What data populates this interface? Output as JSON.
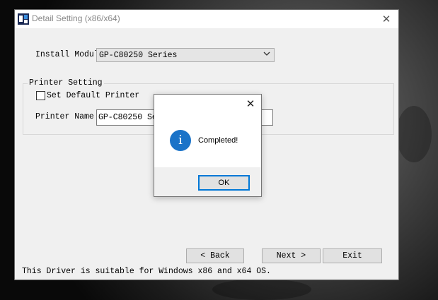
{
  "window": {
    "title": "Detail Setting (x86/x64)",
    "close_glyph": "✕"
  },
  "install": {
    "label": "Install Module",
    "selected": "GP-C80250 Series"
  },
  "printer_setting": {
    "group_title": "Printer Setting",
    "default_checkbox_label": "Set Default Printer",
    "default_checked": false,
    "name_label": "Printer Name",
    "name_value": "GP-C80250 Series"
  },
  "buttons": {
    "back": "< Back",
    "next": "Next >",
    "exit": "Exit"
  },
  "footer_text": "This Driver is suitable for Windows x86 and x64 OS.",
  "dialog": {
    "close_glyph": "✕",
    "icon_glyph": "i",
    "message": "Completed!",
    "ok_label": "OK"
  },
  "icons": [
    "app-icon",
    "close-icon",
    "chevron-down-icon",
    "info-icon"
  ],
  "colors": {
    "accent": "#0078d7",
    "info": "#1a73c8"
  }
}
